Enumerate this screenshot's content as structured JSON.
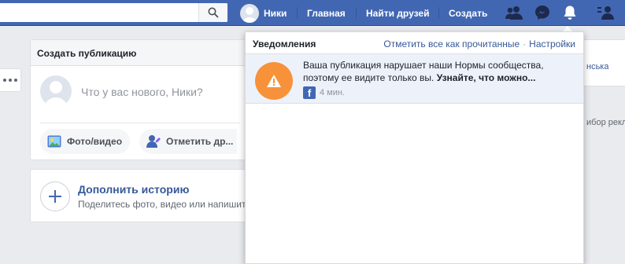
{
  "topbar": {
    "user_name": "Ники",
    "home": "Главная",
    "find_friends": "Найти друзей",
    "create": "Создать",
    "icons": [
      "friends-icon",
      "messenger-icon",
      "notifications-bell-icon",
      "quick-help-icon"
    ]
  },
  "composer": {
    "header": "Создать публикацию",
    "placeholder": "Что у вас нового, Ники?",
    "photo_video": "Фото/видео",
    "tag_friends": "Отметить др..."
  },
  "story": {
    "title": "Дополнить историю",
    "subtitle": "Поделитесь фото, видео или напишит"
  },
  "right_column": {
    "text1": "нська",
    "text2": "ибор рекл"
  },
  "notifications": {
    "title": "Уведомления",
    "mark_all_read": "Отметить все как прочитанные",
    "settings": "Настройки",
    "items": [
      {
        "text": "Ваша публикация нарушает наши Нормы сообщества, поэтому ее видите только вы.",
        "link_text": "Узнайте, что можно...",
        "time": "4 мин."
      }
    ]
  },
  "colors": {
    "topbar": "#4267b2",
    "warning": "#f7923a",
    "link": "#365899",
    "unread_bg": "#edf2fa"
  }
}
